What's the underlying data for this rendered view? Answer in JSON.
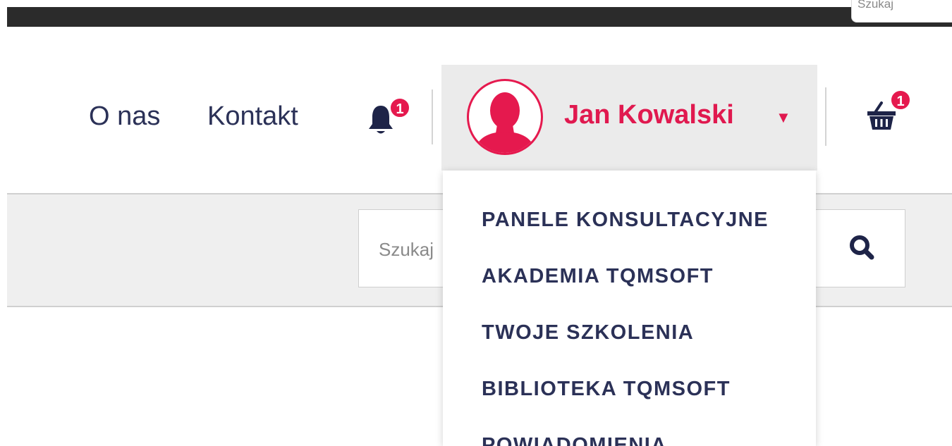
{
  "top_search": {
    "placeholder": "Szukaj"
  },
  "nav": {
    "links": [
      "O nas",
      "Kontakt"
    ]
  },
  "notifications": {
    "count": "1",
    "icon": "bell-icon"
  },
  "user": {
    "name": "Jan Kowalski",
    "avatar_icon": "user-avatar-icon",
    "caret_icon": "caret-down-icon"
  },
  "cart": {
    "count": "1",
    "icon": "basket-icon"
  },
  "search": {
    "placeholder": "Szukaj",
    "button_icon": "search-icon"
  },
  "dropdown": {
    "items": [
      "PANELE KONSULTACYJNE",
      "AKADEMIA TQMSOFT",
      "TWOJE SZKOLENIA",
      "BIBLIOTEKA TQMSOFT",
      "POWIADOMIENIA"
    ]
  },
  "colors": {
    "accent": "#e0194f",
    "navy": "#2b3157",
    "topbar": "#2b2b2b",
    "panel": "#ebebeb"
  }
}
